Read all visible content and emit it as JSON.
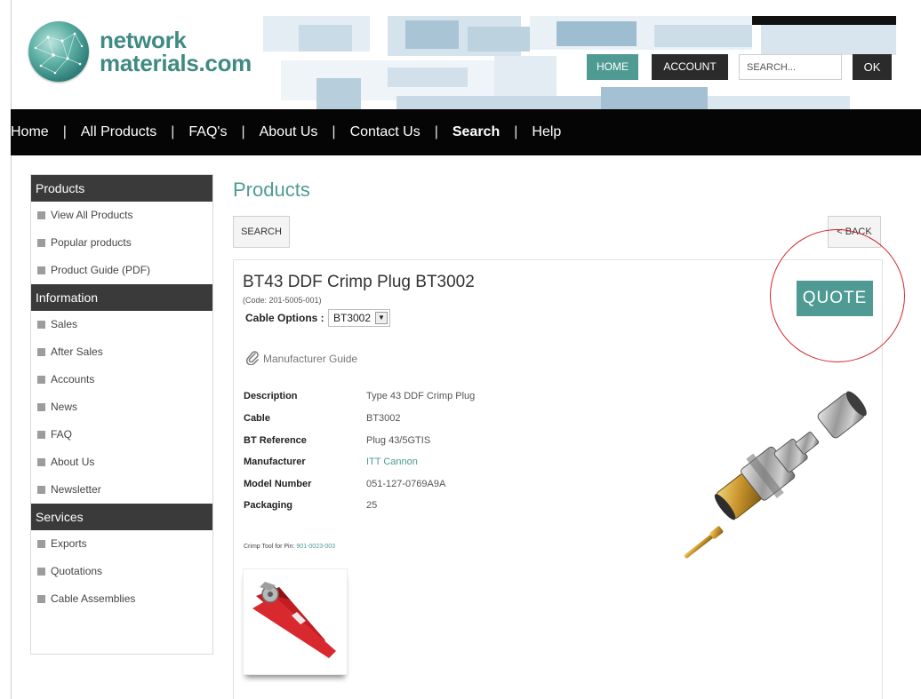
{
  "header": {
    "logo_line1": "network",
    "logo_line2": "materials.com",
    "home_label": "HOME",
    "account_label": "ACCOUNT",
    "search_placeholder": "SEARCH...",
    "ok_label": "OK"
  },
  "nav": {
    "items": [
      {
        "label": "Home"
      },
      {
        "label": "All Products"
      },
      {
        "label": "FAQ's"
      },
      {
        "label": "About Us"
      },
      {
        "label": "Contact Us"
      },
      {
        "label": "Search"
      },
      {
        "label": "Help"
      }
    ],
    "separator": "|"
  },
  "sidebar": {
    "sections": [
      {
        "title": "Products",
        "items": [
          "View All Products",
          "Popular products",
          "Product Guide (PDF)"
        ]
      },
      {
        "title": "Information",
        "items": [
          "Sales",
          "After Sales",
          "Accounts",
          "News",
          "FAQ",
          "About Us",
          "Newsletter"
        ]
      },
      {
        "title": "Services",
        "items": [
          "Exports",
          "Quotations",
          "Cable Assemblies"
        ]
      }
    ]
  },
  "main": {
    "title": "Products",
    "search_button": "SEARCH",
    "back_button": "< BACK"
  },
  "product": {
    "title": "BT43 DDF Crimp Plug BT3002",
    "code": "(Code: 201-5005-001)",
    "cable_options_label": "Cable Options :",
    "cable_option_selected": "BT3002",
    "manufacturer_guide": "Manufacturer Guide",
    "quote_button": "QUOTE",
    "specs": [
      {
        "key": "Description",
        "value": "Type 43 DDF Crimp Plug"
      },
      {
        "key": "Cable",
        "value": "BT3002"
      },
      {
        "key": "BT Reference",
        "value": "Plug 43/5GTIS"
      },
      {
        "key": "Manufacturer",
        "value": "ITT Cannon"
      },
      {
        "key": "Model Number",
        "value": "051-127-0769A9A"
      },
      {
        "key": "Packaging",
        "value": "25"
      }
    ],
    "crimp_label": "Crimp Tool for Pin:",
    "crimp_value": "901-0023-003"
  },
  "colors": {
    "accent": "#4f9b94",
    "dark": "#2b2b2b",
    "nav_bg": "#050505",
    "highlight_circle": "#d3232a"
  }
}
